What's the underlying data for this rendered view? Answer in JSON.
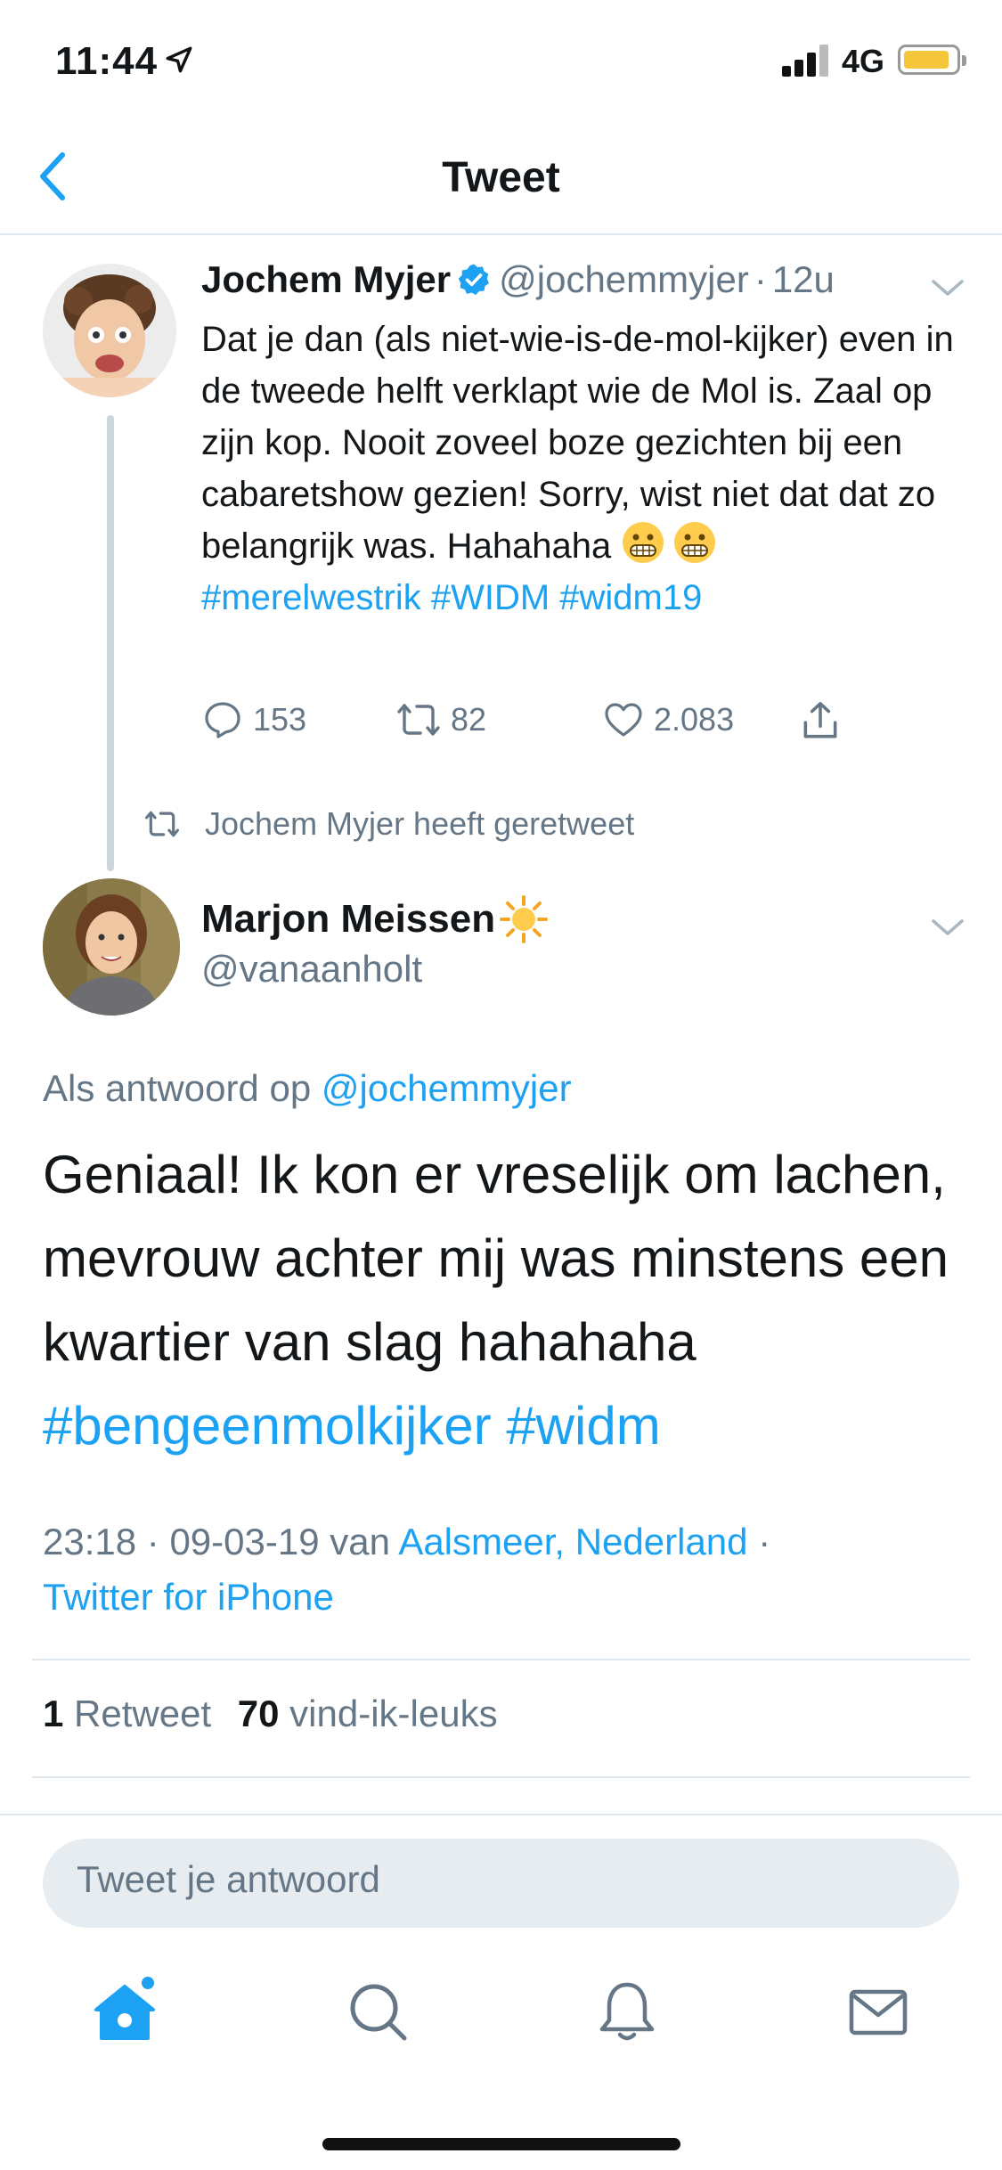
{
  "status_bar": {
    "time": "11:44",
    "network": "4G",
    "battery_color": "#f5c53a"
  },
  "nav": {
    "title": "Tweet"
  },
  "tweet1": {
    "name": "Jochem Myjer",
    "handle": "@jochemmyjer",
    "separator": "·",
    "time": "12u",
    "text": "Dat je dan (als niet-wie-is-de-mol-kijker) even in de tweede helft verklapt wie de Mol is. Zaal op zijn kop. Nooit zoveel boze gezichten bij een cabaretshow gezien! Sorry, wist niet dat dat zo belangrijk was. Hahahaha",
    "hashtags": "#merelwestrik #WIDM #widm19",
    "emoji": [
      "grimacing-face",
      "grimacing-face"
    ],
    "replies": "153",
    "retweets": "82",
    "likes": "2.083"
  },
  "retweet_notice": "Jochem Myjer heeft geretweet",
  "tweet2": {
    "name": "Marjon Meissen",
    "handle": "@vanaanholt",
    "reply_prefix": "Als antwoord op",
    "reply_to": "@jochemmyjer",
    "text": "Geniaal! Ik kon er vreselijk om lachen, mevrouw achter mij was minstens een kwartier van slag hahahaha",
    "hashtags": "#bengeenmolkijker #widm",
    "time": "23:18",
    "date": "09-03-19",
    "from_label": "van",
    "location": "Aalsmeer, Nederland",
    "source": "Twitter for iPhone",
    "retweet_count": "1",
    "retweet_label": "Retweet",
    "like_count": "70",
    "like_label": "vind-ik-leuks"
  },
  "composer": {
    "placeholder": "Tweet je antwoord"
  },
  "colors": {
    "accent": "#1da1f2",
    "muted": "#657786",
    "text": "#14171a"
  }
}
